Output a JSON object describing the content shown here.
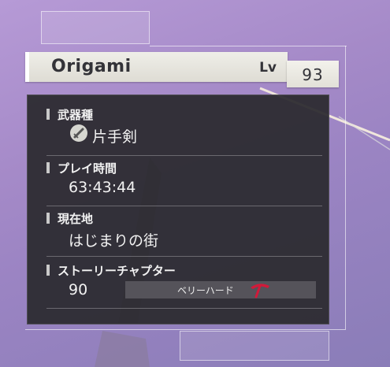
{
  "character": {
    "name": "Origami",
    "level_label": "Lv",
    "level": "93"
  },
  "save_info": {
    "weapon_type_label": "武器種",
    "weapon_type_value": "片手剣",
    "weapon_icon": "sword-icon",
    "play_time_label": "プレイ時間",
    "play_time_value": "63:43:44",
    "location_label": "現在地",
    "location_value": "はじまりの街",
    "story_chapter_label": "ストーリーチャプター",
    "story_chapter_value": "90",
    "difficulty": "ベリーハード",
    "difficulty_icon": "pickaxe-icon"
  },
  "colors": {
    "panel": "#2c2a30",
    "name_bar": "#e8e6e0",
    "difficulty_icon": "#d11a3a"
  }
}
